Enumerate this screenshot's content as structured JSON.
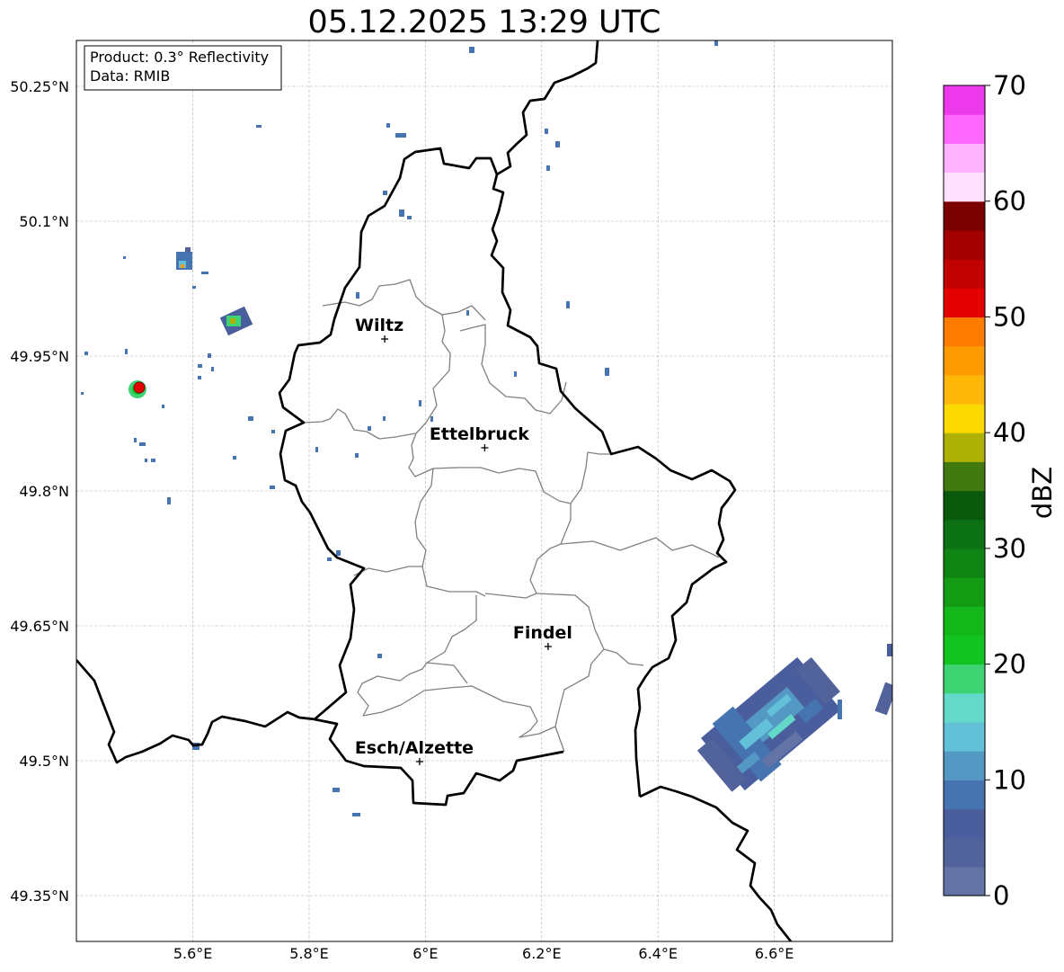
{
  "title": "05.12.2025 13:29 UTC",
  "info_box": {
    "line1": "Product: 0.3° Reflectivity",
    "line2": "Data: RMIB"
  },
  "map": {
    "lon_ticks": [
      {
        "value": 5.6,
        "label": "5.6°E"
      },
      {
        "value": 5.8,
        "label": "5.8°E"
      },
      {
        "value": 6.0,
        "label": "6°E"
      },
      {
        "value": 6.2,
        "label": "6.2°E"
      },
      {
        "value": 6.4,
        "label": "6.4°E"
      },
      {
        "value": 6.6,
        "label": "6.6°E"
      }
    ],
    "lat_ticks": [
      {
        "value": 50.25,
        "label": "50.25°N"
      },
      {
        "value": 50.1,
        "label": "50.1°N"
      },
      {
        "value": 49.95,
        "label": "49.95°N"
      },
      {
        "value": 49.8,
        "label": "49.8°N"
      },
      {
        "value": 49.65,
        "label": "49.65°N"
      },
      {
        "value": 49.5,
        "label": "49.5°N"
      },
      {
        "value": 49.35,
        "label": "49.35°N"
      }
    ],
    "cities": [
      {
        "name": "Wiltz",
        "lon": 5.93,
        "lat": 49.969
      },
      {
        "name": "Ettelbruck",
        "lon": 6.102,
        "lat": 49.848
      },
      {
        "name": "Findel",
        "lon": 6.211,
        "lat": 49.627
      },
      {
        "name": "Esch/Alzette",
        "lon": 5.99,
        "lat": 49.499
      }
    ]
  },
  "colorbar": {
    "label": "dBZ",
    "ticks": [
      0,
      10,
      20,
      30,
      40,
      50,
      60,
      70
    ],
    "colors": [
      "#6373a6",
      "#52639b",
      "#4a5e9d",
      "#4674b0",
      "#5499c4",
      "#63c0d9",
      "#65d9c9",
      "#3fd473",
      "#12c41f",
      "#13b719",
      "#129b13",
      "#0f8412",
      "#0c7112",
      "#085a0a",
      "#437911",
      "#aeb106",
      "#fed900",
      "#feb707",
      "#fd9c00",
      "#fd7c00",
      "#e40000",
      "#c10000",
      "#a30000",
      "#7d0000",
      "#ffe1ff",
      "#ffb2ff",
      "#ff68ff",
      "#eb39eb"
    ]
  }
}
